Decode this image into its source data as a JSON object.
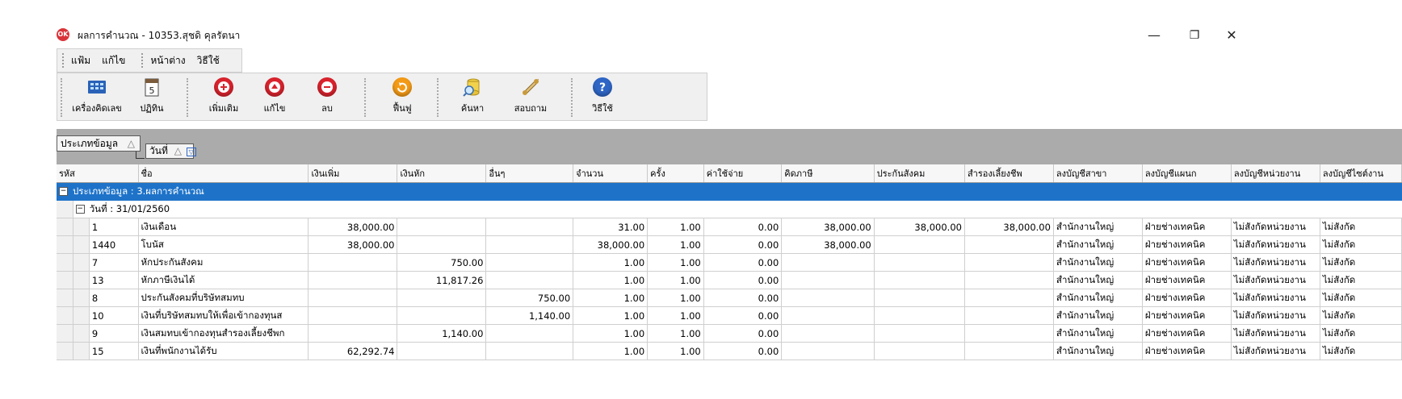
{
  "window": {
    "app_icon": "OK",
    "title": "ผลการคำนวณ - 10353.สุชดิ คุลรัตนา",
    "controls": {
      "minimize": "—",
      "restore": "❐",
      "close": "✕"
    }
  },
  "menu": [
    "แฟ้ม",
    "แก้ไข",
    "หน้าต่าง",
    "วิธีใช้"
  ],
  "toolbar": [
    {
      "label": "เครื่องคิดเลข",
      "icon": "calculator-icon"
    },
    {
      "label": "ปฏิทิน",
      "icon": "calendar-icon",
      "icon_text": "5"
    },
    {
      "label": "เพิ่มเติม",
      "icon": "add-icon",
      "color": "#d9232d"
    },
    {
      "label": "แก้ไข",
      "icon": "edit-icon",
      "color": "#d9232d"
    },
    {
      "label": "ลบ",
      "icon": "delete-icon",
      "color": "#d9232d"
    },
    {
      "label": "ฟื้นฟู",
      "icon": "refresh-icon",
      "color": "#f39a16"
    },
    {
      "label": "ค้นหา",
      "icon": "search-icon"
    },
    {
      "label": "สอบถาม",
      "icon": "phone-icon"
    },
    {
      "label": "วิธีใช้",
      "icon": "help-icon",
      "color": "#2f66c6"
    }
  ],
  "grouping": {
    "level1": "ประเภทข้อมูล",
    "level2": "วันที่",
    "sort_mark": "△",
    "filter_mark": "▽"
  },
  "columns": [
    "รหัส",
    "ชื่อ",
    "เงินเพิ่ม",
    "เงินหัก",
    "อื่นๆ",
    "จำนวน",
    "ครั้ง",
    "ค่าใช้จ่าย",
    "คิดภาษี",
    "ประกันสังคม",
    "สำรองเลี้ยงชีพ",
    "ลงบัญชีสาขา",
    "ลงบัญชีแผนก",
    "ลงบัญชีหน่วยงาน",
    "ลงบัญชีไซต์งาน"
  ],
  "group_header": "ประเภทข้อมูล : 3.ผลการคำนวณ",
  "date_header": "วันที่ : 31/01/2560",
  "rows": [
    [
      "1",
      "เงินเดือน",
      "38,000.00",
      "",
      "",
      "31.00",
      "1.00",
      "0.00",
      "38,000.00",
      "38,000.00",
      "38,000.00",
      "สำนักงานใหญ่",
      "ฝ่ายช่างเทคนิค",
      "ไม่สังกัดหน่วยงาน",
      "ไม่สังกัด"
    ],
    [
      "1440",
      "โบนัส",
      "38,000.00",
      "",
      "",
      "38,000.00",
      "1.00",
      "0.00",
      "38,000.00",
      "",
      "",
      "สำนักงานใหญ่",
      "ฝ่ายช่างเทคนิค",
      "ไม่สังกัดหน่วยงาน",
      "ไม่สังกัด"
    ],
    [
      "7",
      "หักประกันสังคม",
      "",
      "750.00",
      "",
      "1.00",
      "1.00",
      "0.00",
      "",
      "",
      "",
      "สำนักงานใหญ่",
      "ฝ่ายช่างเทคนิค",
      "ไม่สังกัดหน่วยงาน",
      "ไม่สังกัด"
    ],
    [
      "13",
      "หักภาษีเงินได้",
      "",
      "11,817.26",
      "",
      "1.00",
      "1.00",
      "0.00",
      "",
      "",
      "",
      "สำนักงานใหญ่",
      "ฝ่ายช่างเทคนิค",
      "ไม่สังกัดหน่วยงาน",
      "ไม่สังกัด"
    ],
    [
      "8",
      "ประกันสังคมที่บริษัทสมทบ",
      "",
      "",
      "750.00",
      "1.00",
      "1.00",
      "0.00",
      "",
      "",
      "",
      "สำนักงานใหญ่",
      "ฝ่ายช่างเทคนิค",
      "ไม่สังกัดหน่วยงาน",
      "ไม่สังกัด"
    ],
    [
      "10",
      "เงินที่บริษัทสมทบให้เพื่อเข้ากองทุนส",
      "",
      "",
      "1,140.00",
      "1.00",
      "1.00",
      "0.00",
      "",
      "",
      "",
      "สำนักงานใหญ่",
      "ฝ่ายช่างเทคนิค",
      "ไม่สังกัดหน่วยงาน",
      "ไม่สังกัด"
    ],
    [
      "9",
      "เงินสมทบเข้ากองทุนสำรองเลี้ยงชีพก",
      "",
      "1,140.00",
      "",
      "1.00",
      "1.00",
      "0.00",
      "",
      "",
      "",
      "สำนักงานใหญ่",
      "ฝ่ายช่างเทคนิค",
      "ไม่สังกัดหน่วยงาน",
      "ไม่สังกัด"
    ],
    [
      "15",
      "เงินที่พนักงานได้รับ",
      "62,292.74",
      "",
      "",
      "1.00",
      "1.00",
      "0.00",
      "",
      "",
      "",
      "สำนักงานใหญ่",
      "ฝ่ายช่างเทคนิค",
      "ไม่สังกัดหน่วยงาน",
      "ไม่สังกัด"
    ]
  ]
}
